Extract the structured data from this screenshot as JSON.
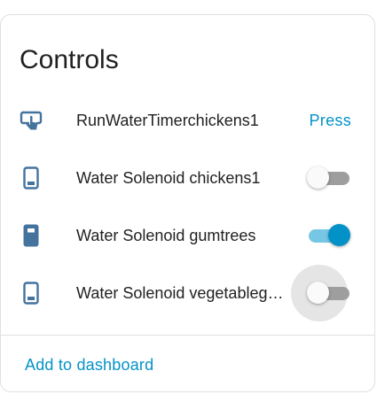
{
  "card": {
    "title": "Controls",
    "footer_link": "Add to dashboard"
  },
  "accent_color": "#0392c7",
  "icon_color": "#44739e",
  "entities": [
    {
      "label": "RunWaterTimerchickens1",
      "icon": "gesture-tap-button-icon",
      "control": "button",
      "action_label": "Press"
    },
    {
      "label": "Water Solenoid chickens1",
      "icon": "cellphone-outline-icon",
      "control": "switch",
      "state": "off"
    },
    {
      "label": "Water Solenoid gumtrees",
      "icon": "cellphone-filled-icon",
      "control": "switch",
      "state": "on"
    },
    {
      "label": "Water Solenoid vegetablegarden",
      "icon": "cellphone-outline-icon",
      "control": "switch",
      "state": "off",
      "focused": true
    }
  ]
}
